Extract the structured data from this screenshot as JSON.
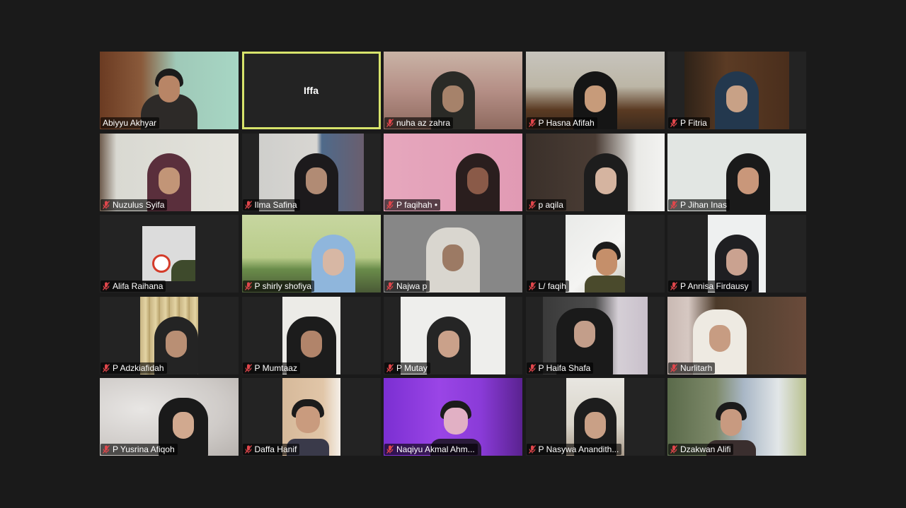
{
  "meeting": {
    "active_speaker": "Iffa",
    "participants": [
      {
        "name": "Abiyyu Akhyar",
        "muted": false
      },
      {
        "name": "Iffa",
        "muted": false
      },
      {
        "name": "nuha az zahra",
        "muted": true
      },
      {
        "name": "P Hasna Afifah",
        "muted": true
      },
      {
        "name": "P Fitria",
        "muted": true
      },
      {
        "name": "Nuzulus Syifa",
        "muted": true
      },
      {
        "name": "Ilma Safina",
        "muted": true
      },
      {
        "name": "P faqihah •",
        "muted": true
      },
      {
        "name": "p aqila",
        "muted": true
      },
      {
        "name": "P Jihan Inas",
        "muted": true
      },
      {
        "name": "Alifa Raihana",
        "muted": true
      },
      {
        "name": "P shirly shofiya",
        "muted": true
      },
      {
        "name": "Najwa p",
        "muted": true
      },
      {
        "name": "L/ faqih",
        "muted": true
      },
      {
        "name": "P Annisa Firdausy",
        "muted": true
      },
      {
        "name": "P Adzkiafidah",
        "muted": true
      },
      {
        "name": "P Mumtaaz",
        "muted": true
      },
      {
        "name": "P Mutay",
        "muted": true
      },
      {
        "name": "P Haifa Shafa",
        "muted": true
      },
      {
        "name": "Nurlitarh",
        "muted": true
      },
      {
        "name": "P Yusrina Afiqoh",
        "muted": true
      },
      {
        "name": "Daffa Hanif",
        "muted": true
      },
      {
        "name": "Naqiyu Akmal Ahm...",
        "muted": true
      },
      {
        "name": "P Nasywa Anandith...",
        "muted": true
      },
      {
        "name": "Dzakwan Alifi",
        "muted": true
      }
    ]
  },
  "colors": {
    "background": "#1a1a1a",
    "tile": "#232323",
    "active_border": "#d7e36b",
    "mute_red": "#e0464b"
  },
  "icons": {
    "muted": "microphone-muted-icon"
  }
}
